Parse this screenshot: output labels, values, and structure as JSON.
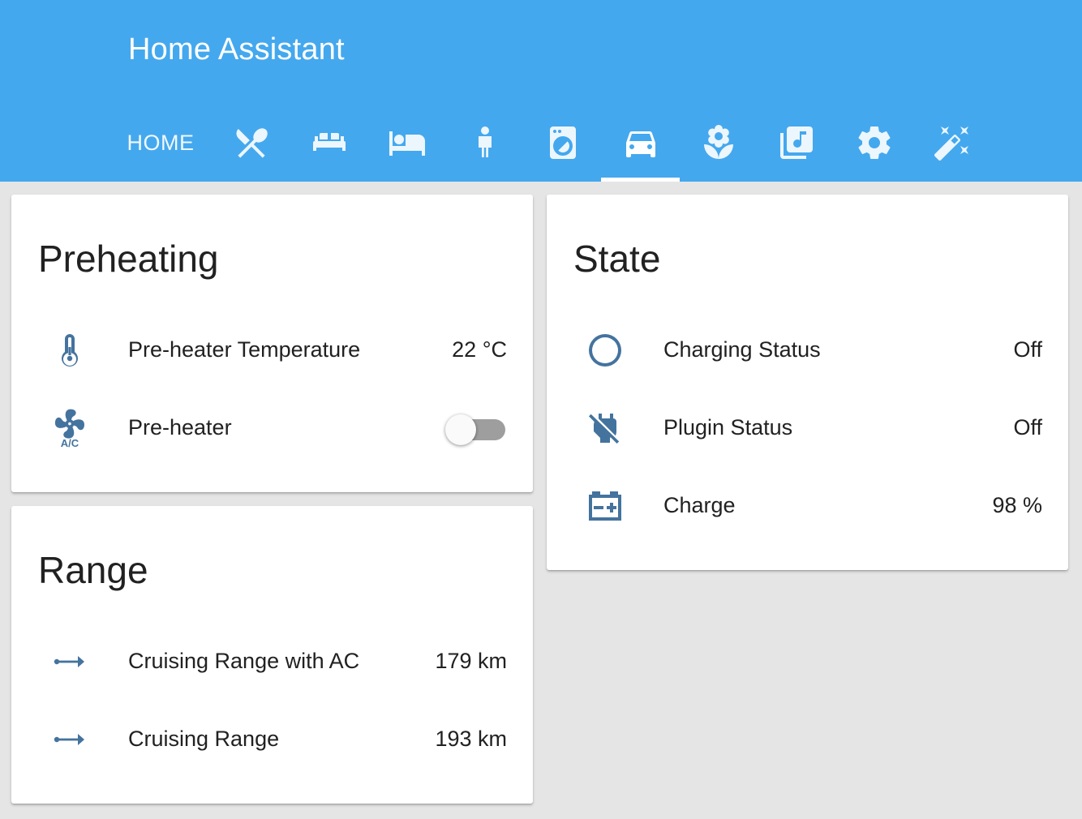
{
  "header": {
    "title": "Home Assistant",
    "tabs": [
      {
        "label": "HOME",
        "icon": "home-text"
      },
      {
        "icon": "silverware-icon"
      },
      {
        "icon": "sofa-icon"
      },
      {
        "icon": "bed-icon"
      },
      {
        "icon": "person-icon"
      },
      {
        "icon": "washing-machine-icon"
      },
      {
        "icon": "car-icon",
        "active": true
      },
      {
        "icon": "flower-icon"
      },
      {
        "icon": "music-library-icon"
      },
      {
        "icon": "settings-icon"
      },
      {
        "icon": "auto-fix-icon"
      }
    ]
  },
  "cards": {
    "preheating": {
      "title": "Preheating",
      "rows": [
        {
          "label": "Pre-heater Temperature",
          "value": "22 °C",
          "icon": "thermometer-icon"
        },
        {
          "label": "Pre-heater",
          "icon": "air-conditioner-icon",
          "toggle": false
        }
      ]
    },
    "range": {
      "title": "Range",
      "rows": [
        {
          "label": "Cruising Range with AC",
          "value": "179 km",
          "icon": "arrow-right-icon"
        },
        {
          "label": "Cruising Range",
          "value": "193 km",
          "icon": "arrow-right-icon"
        }
      ]
    },
    "state": {
      "title": "State",
      "rows": [
        {
          "label": "Charging Status",
          "value": "Off",
          "icon": "circle-outline-icon"
        },
        {
          "label": "Plugin Status",
          "value": "Off",
          "icon": "power-plug-off-icon"
        },
        {
          "label": "Charge",
          "value": "98 %",
          "icon": "car-battery-icon"
        }
      ]
    }
  },
  "colors": {
    "header": "#44a8ee",
    "icon": "#44739e",
    "background": "#e5e5e5"
  }
}
